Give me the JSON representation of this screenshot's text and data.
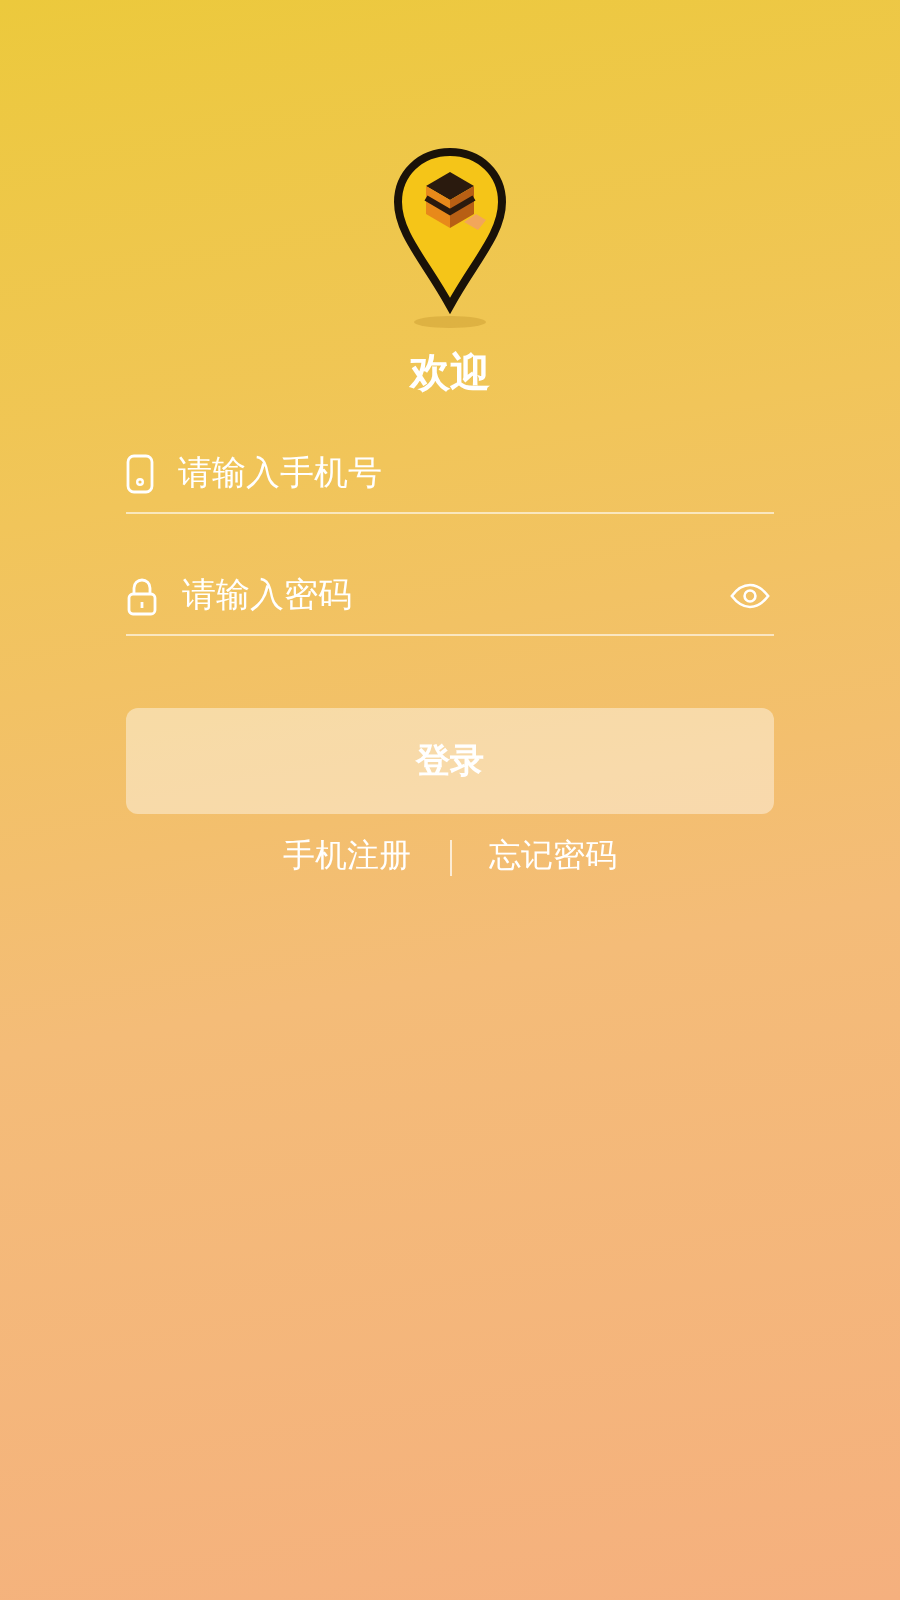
{
  "welcome": "欢迎",
  "fields": [
    {
      "kind": "phone",
      "placeholder": "请输入手机号"
    },
    {
      "kind": "password",
      "placeholder": "请输入密码"
    }
  ],
  "login_button": "登录",
  "links": [
    "手机注册",
    "忘记密码"
  ]
}
